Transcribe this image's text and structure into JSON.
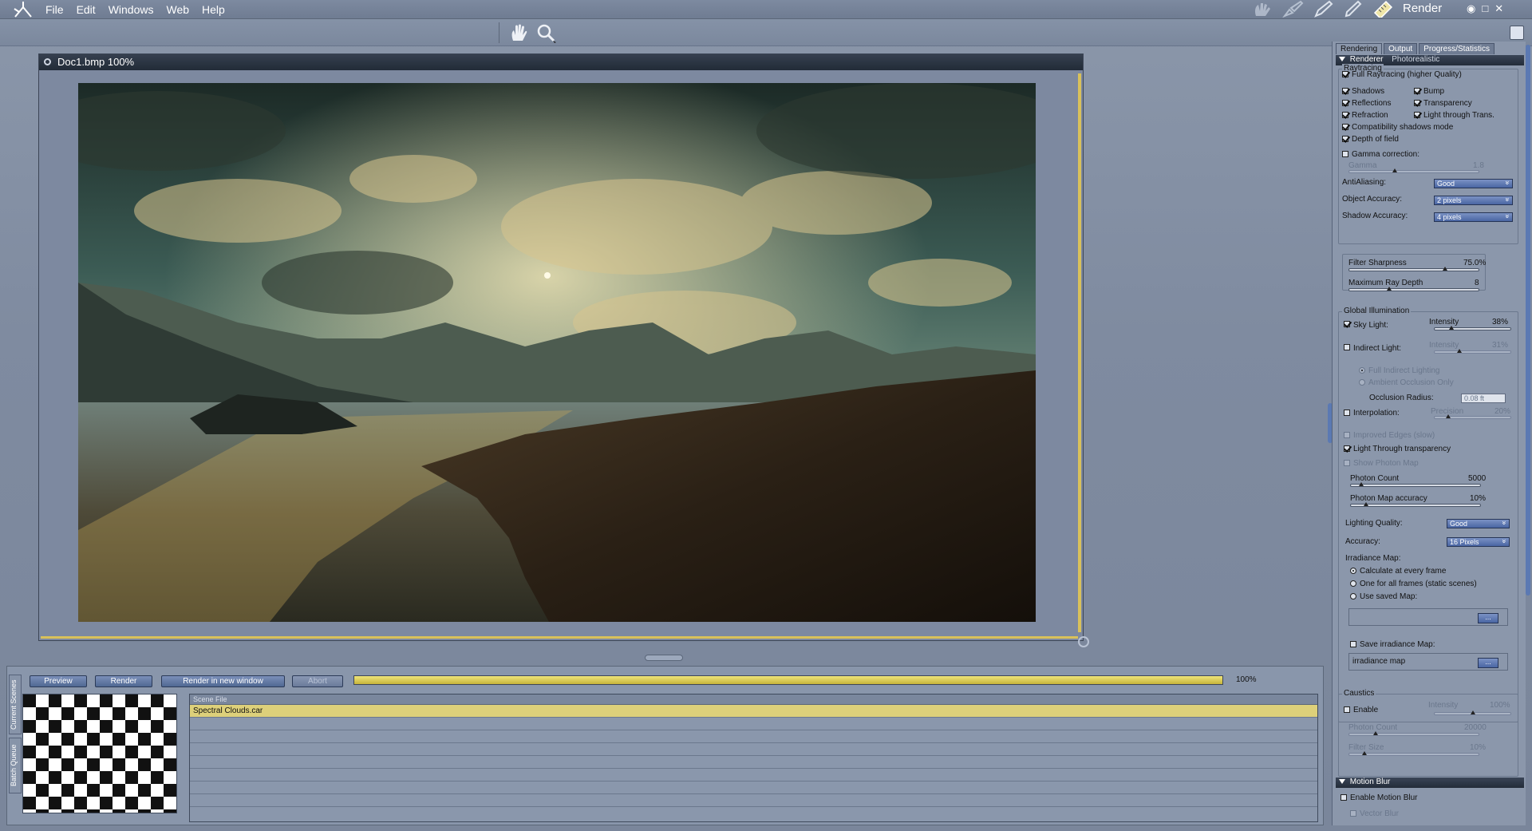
{
  "menubar": {
    "items": [
      "File",
      "Edit",
      "Windows",
      "Web",
      "Help"
    ],
    "room_title": "Render",
    "tool_icons": [
      "hand-ghost-icon",
      "brush-ghost-icon",
      "pen-icon",
      "pencil-icon",
      "ruler-icon"
    ],
    "window_controls": [
      "eye-icon",
      "maximize-icon",
      "close-icon"
    ]
  },
  "toolbar": {
    "icons": [
      "hand-icon",
      "zoom-icon"
    ]
  },
  "document": {
    "title": "Doc1.bmp 100%"
  },
  "bottom": {
    "side_tabs": [
      "Current Scenes",
      "Batch Queue"
    ],
    "buttons": {
      "preview": "Preview",
      "render": "Render",
      "render_new": "Render in new window",
      "abort": "Abort"
    },
    "progress": 100,
    "progress_label": "100%",
    "queue_header": "Scene File",
    "queue_rows": [
      "Spectral Clouds.car",
      "",
      "",
      "",
      "",
      "",
      "",
      ""
    ]
  },
  "panel": {
    "tabs": [
      "Rendering",
      "Output",
      "Progress/Statistics"
    ],
    "renderer": {
      "label": "Renderer",
      "value": "Photorealistic"
    },
    "raytracing": {
      "title": "Raytracing",
      "full": "Full Raytracing (higher Quality)",
      "shadows": "Shadows",
      "bump": "Bump",
      "reflections": "Reflections",
      "transparency": "Transparency",
      "refraction": "Refraction",
      "light_through_trans": "Light through Trans.",
      "compat_shadows": "Compatibility shadows mode",
      "dof": "Depth of field",
      "gamma_corr": "Gamma correction:",
      "gamma_label": "Gamma",
      "gamma_value": "1.8"
    },
    "antialiasing": {
      "label": "AntiAliasing:",
      "value": "Good"
    },
    "object_accuracy": {
      "label": "Object Accuracy:",
      "value": "2 pixels"
    },
    "shadow_accuracy": {
      "label": "Shadow Accuracy:",
      "value": "4 pixels"
    },
    "filter_sharpness": {
      "label": "Filter Sharpness",
      "value": "75.0%",
      "level": 0.75
    },
    "max_ray_depth": {
      "label": "Maximum Ray Depth",
      "value": "8",
      "level": 0.3
    },
    "gi": {
      "title": "Global Illumination",
      "sky_light": "Sky Light:",
      "intensity": "Intensity",
      "sky_intensity": "38%",
      "indirect_light": "Indirect Light:",
      "indirect_intensity": "31%",
      "full_indirect": "Full Indirect Lighting",
      "ambient_occlusion": "Ambient Occlusion Only",
      "occlusion_radius_label": "Occlusion Radius:",
      "occlusion_radius": "0.08 ft",
      "interpolation": "Interpolation:",
      "precision": "Precision",
      "precision_value": "20%",
      "improved_edges": "Improved Edges (slow)",
      "light_through_transparency": "Light Through transparency",
      "show_photon_map": "Show Photon Map",
      "photon_count_label": "Photon Count",
      "photon_count": "5000",
      "photon_map_acc_label": "Photon Map accuracy",
      "photon_map_acc": "10%",
      "lighting_quality_label": "Lighting Quality:",
      "lighting_quality": "Good",
      "accuracy_label": "Accuracy:",
      "accuracy": "16 Pixels",
      "irradiance_map": "Irradiance Map:",
      "calc_every": "Calculate at every frame",
      "one_for_all": "One for all frames (static scenes)",
      "use_saved": "Use saved Map:",
      "browse": "...",
      "save_irradiance": "Save irradiance Map:",
      "irradiance_file": "irradiance map"
    },
    "caustics": {
      "title": "Caustics",
      "enable": "Enable",
      "intensity": "Intensity",
      "intensity_value": "100%",
      "photon_count_label": "Photon Count",
      "photon_count": "20000",
      "filter_size_label": "Filter Size",
      "filter_size": "10%"
    },
    "motion_blur": {
      "title": "Motion Blur",
      "enable": "Enable Motion Blur",
      "vector": "Vector Blur"
    }
  },
  "colors": {
    "accent_blue": "#4a66a3",
    "progress_yellow": "#d9c15a",
    "selection_yellow": "#ddd07a"
  }
}
